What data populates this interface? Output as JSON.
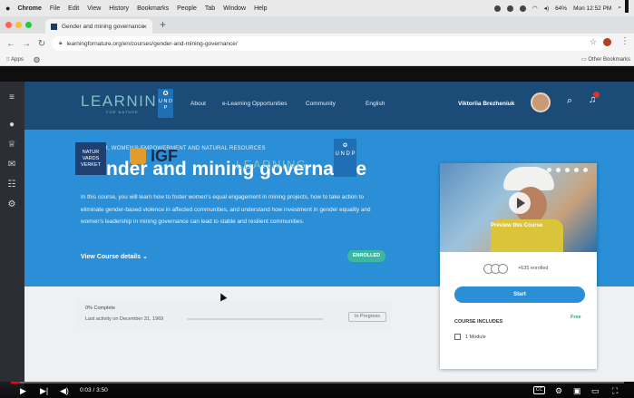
{
  "menubar": {
    "app": "Chrome",
    "items": [
      "File",
      "Edit",
      "View",
      "History",
      "Bookmarks",
      "People",
      "Tab",
      "Window",
      "Help"
    ],
    "battery": "64%",
    "clock": "Mon 12:52 PM"
  },
  "browser": {
    "tab_title": "Gender and mining governance",
    "url": "learningfornature.org/en/courses/gender-and-mining-governance/",
    "bookmarks_apps": "Apps",
    "bookmarks_other": "Other Bookmarks"
  },
  "site": {
    "logo_text": "LEARNING",
    "logo_sub": "FOR NATURE",
    "undp_logo": "U N D P",
    "nav": [
      "About",
      "e-Learning Opportunities",
      "Community",
      "English"
    ],
    "user_name": "Viktoriia Brezheniuk"
  },
  "hero": {
    "category": "POPULAR, WOMEN'S EMPOWERMENT AND NATURAL RESOURCES",
    "title": "Gender and mining governance",
    "description": "In this course, you will learn how to foster women's equal engagement in mining projects, how to take action to eliminate gender-based violence in affected communities, and understand how investment in gender equality and women's leadership in mining governance can lead to stable and resilient communities.",
    "details_link": "View Course details",
    "status_badge": "ENROLLED"
  },
  "progress": {
    "complete": "0% Complete",
    "last_activity": "Last activity on December 31, 1969",
    "status": "In Progress",
    "value": 0
  },
  "partners": {
    "natur": "NATUR VARDS VERKET",
    "igf": "IGF",
    "learning": "LEARNING",
    "undp": "U N D P"
  },
  "course_card": {
    "preview_label": "Preview this Course",
    "enrolled_count": "+635 enrolled",
    "start_label": "Start",
    "includes_label": "COURSE INCLUDES",
    "price": "Free",
    "module_count": "1 Module"
  },
  "player": {
    "time": "0:03 / 3:50",
    "progress": 0.015,
    "cc_label": "CC"
  }
}
